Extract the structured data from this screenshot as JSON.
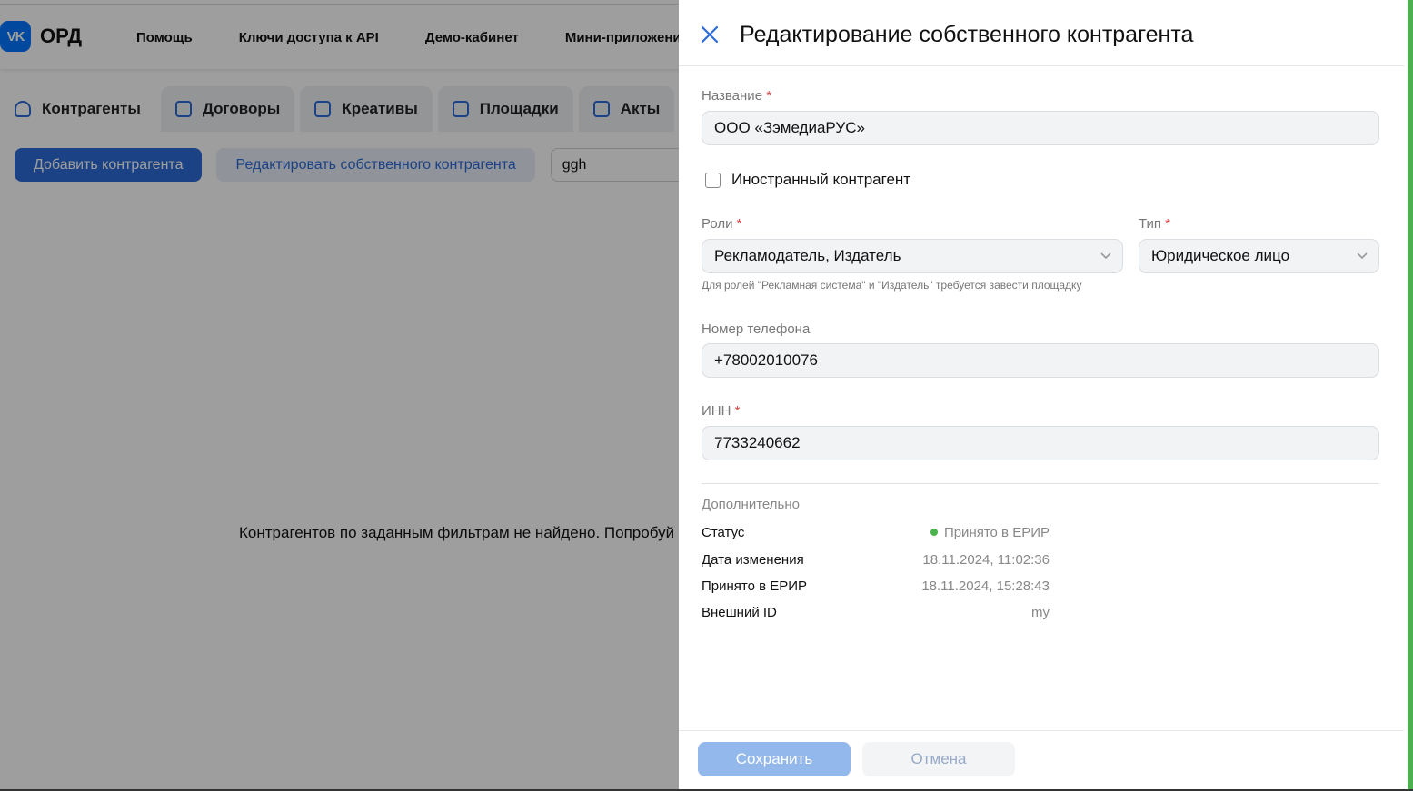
{
  "header": {
    "logo_mark": "VK",
    "logo_text": "ОРД",
    "nav": [
      "Помощь",
      "Ключи доступа к API",
      "Демо-кабинет",
      "Мини-приложение"
    ]
  },
  "tabs": [
    {
      "label": "Контрагенты",
      "icon": "user-icon",
      "active": true
    },
    {
      "label": "Договоры",
      "icon": "book-icon"
    },
    {
      "label": "Креативы",
      "icon": "calendar-icon"
    },
    {
      "label": "Площадки",
      "icon": "megaphone-icon"
    },
    {
      "label": "Акты",
      "icon": "document-icon"
    }
  ],
  "toolbar": {
    "add_label": "Добавить контрагента",
    "edit_own_label": "Редактировать собственного контрагента",
    "search_value": "ggh"
  },
  "empty_message": "Контрагентов по заданным фильтрам не найдено. Попробуй",
  "panel": {
    "title": "Редактирование собственного контрагента",
    "name_label": "Название",
    "name_value": "ООО «ЗэмедиаРУС»",
    "foreign_label": "Иностранный контрагент",
    "foreign_checked": false,
    "roles_label": "Роли",
    "roles_value": "Рекламодатель, Издатель",
    "roles_hint": "Для ролей \"Рекламная система\" и \"Издатель\" требуется завести площадку",
    "type_label": "Тип",
    "type_value": "Юридическое лицо",
    "phone_label": "Номер телефона",
    "phone_value": "+78002010076",
    "inn_label": "ИНН",
    "inn_value": "7733240662",
    "additional_title": "Дополнительно",
    "info": {
      "status_label": "Статус",
      "status_value": "Принято в ЕРИР",
      "status_color": "#4bb34b",
      "changed_label": "Дата изменения",
      "changed_value": "18.11.2024, 11:02:36",
      "accepted_label": "Принято в ЕРИР",
      "accepted_value": "18.11.2024, 15:28:43",
      "external_id_label": "Внешний ID",
      "external_id_value": "my"
    },
    "save_label": "Сохранить",
    "cancel_label": "Отмена"
  },
  "colors": {
    "accent": "#2d6bd6",
    "required": "#e03a3a"
  }
}
